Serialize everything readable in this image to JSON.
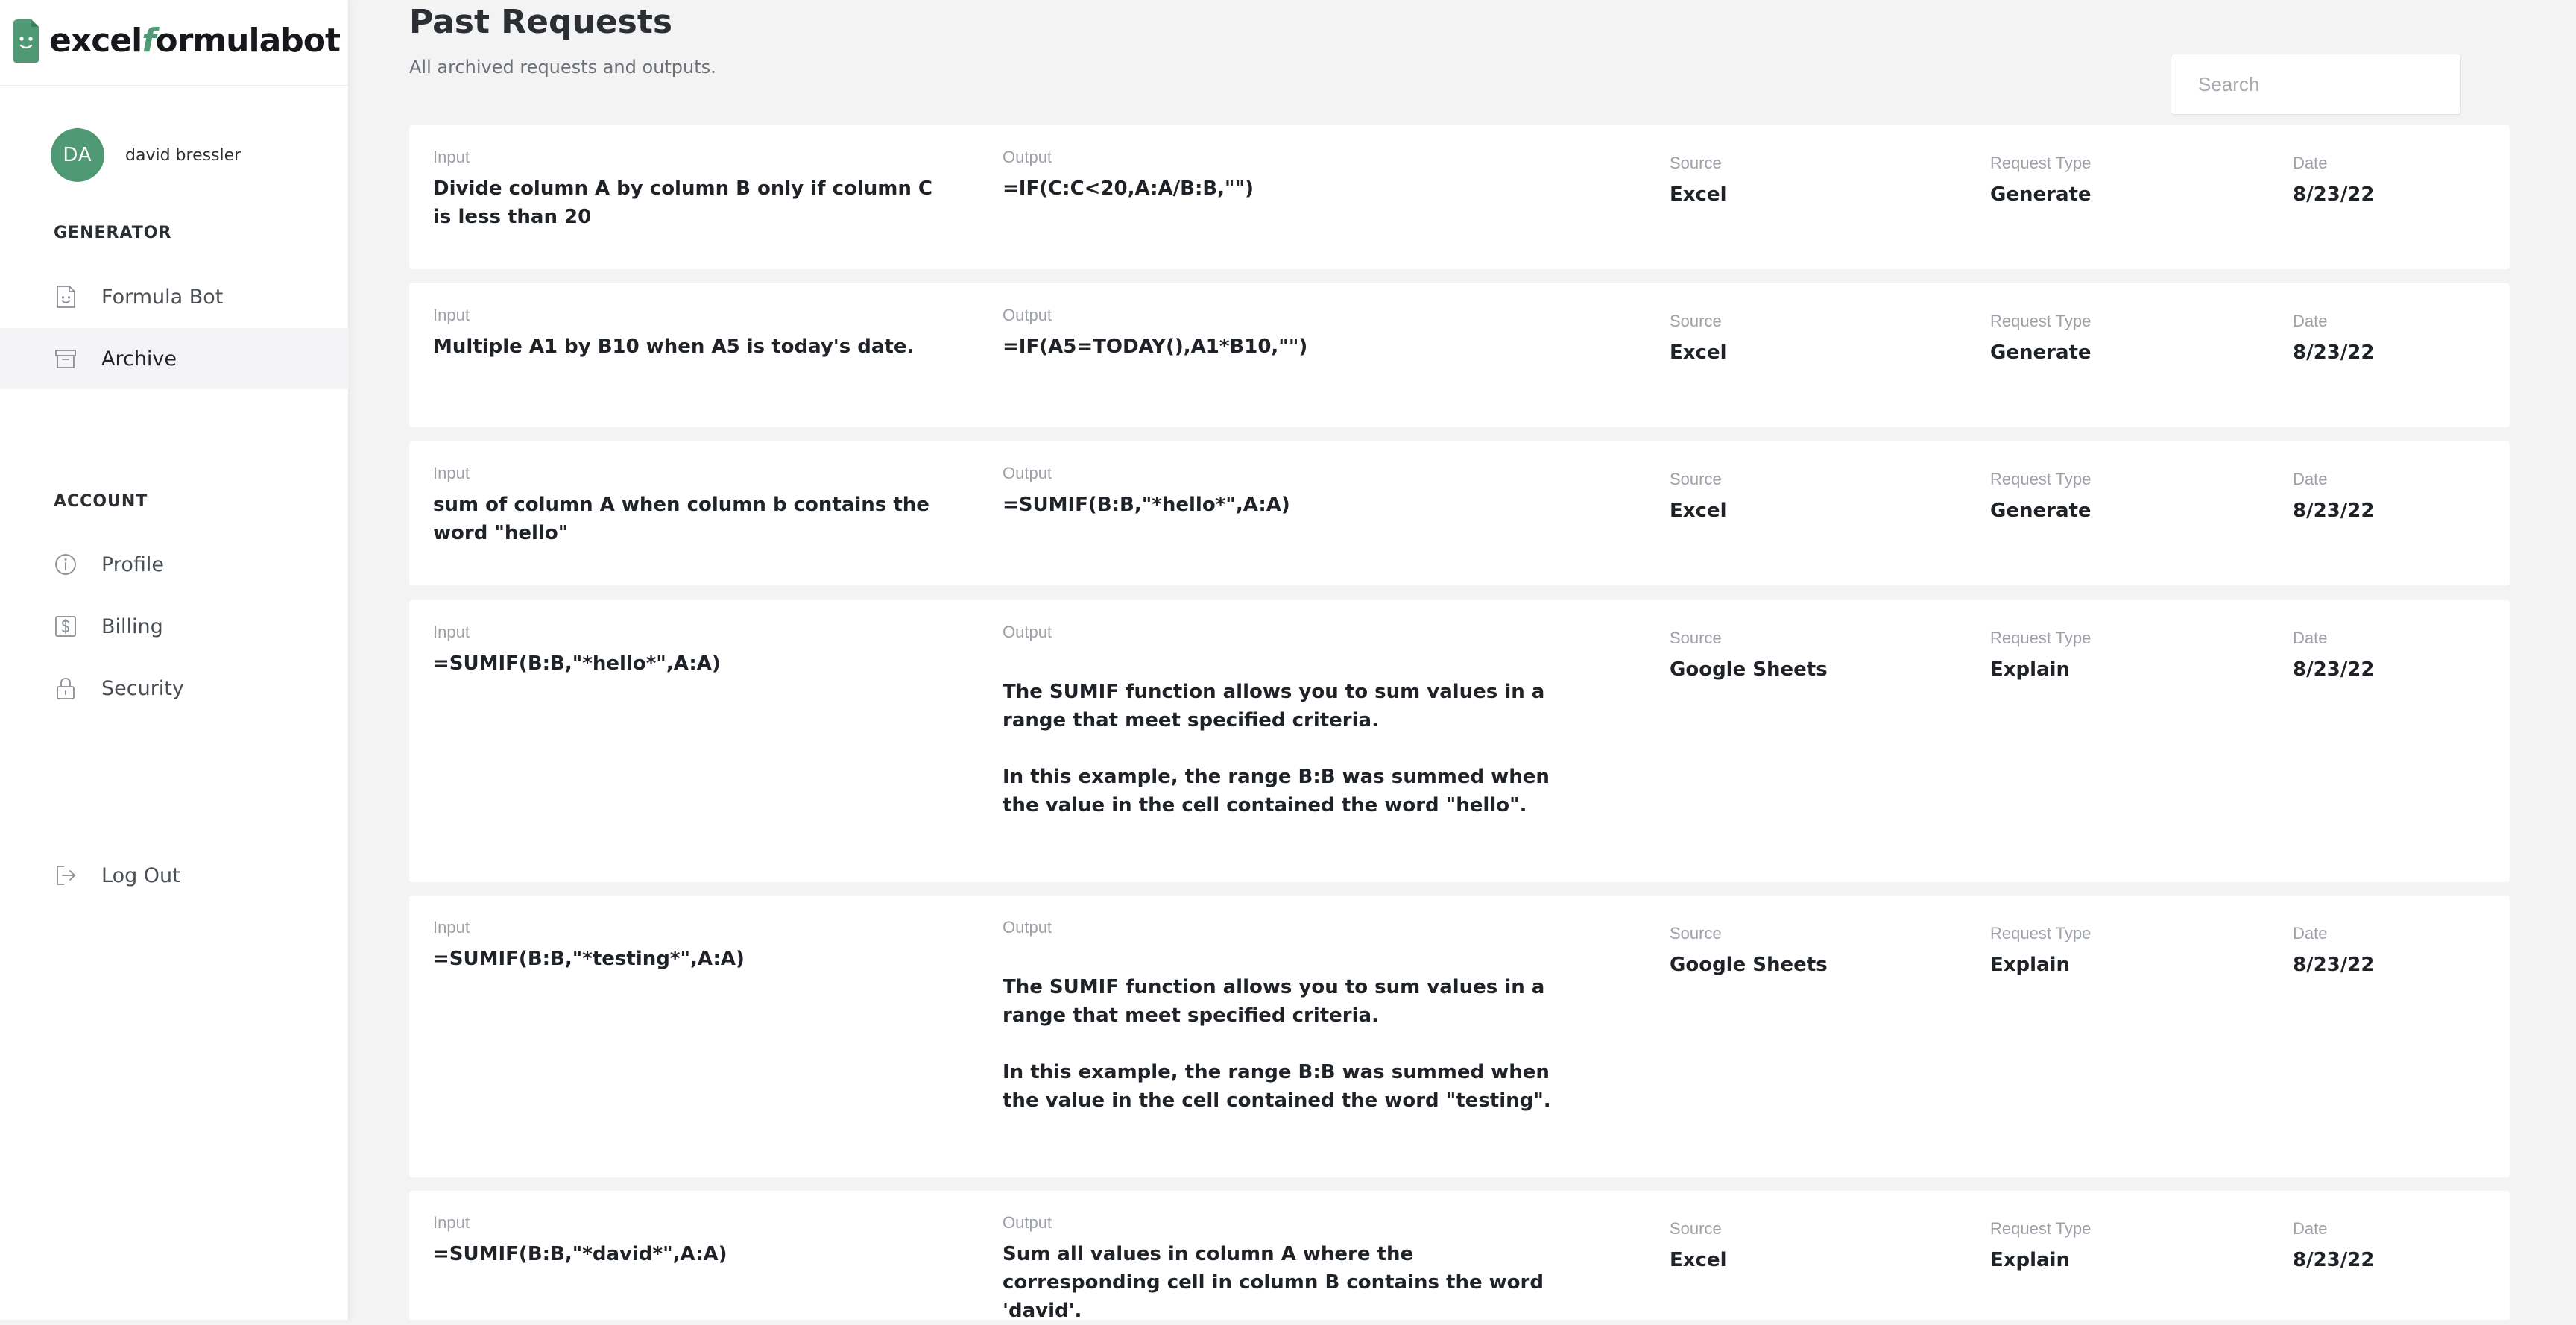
{
  "brand": {
    "name_part1": "excel",
    "name_accent": "f",
    "name_part2": "ormulabot",
    "color": "#4f9a74"
  },
  "user": {
    "initials": "DA",
    "name": "david bressler"
  },
  "sidebar": {
    "generator_label": "GENERATOR",
    "generator_items": [
      {
        "label": "Formula Bot",
        "icon": "document-face-icon",
        "active": false
      },
      {
        "label": "Archive",
        "icon": "archive-box-icon",
        "active": true
      }
    ],
    "account_label": "ACCOUNT",
    "account_items": [
      {
        "label": "Profile",
        "icon": "info-circle-icon"
      },
      {
        "label": "Billing",
        "icon": "dollar-icon"
      },
      {
        "label": "Security",
        "icon": "lock-icon"
      }
    ],
    "logout_label": "Log Out"
  },
  "page": {
    "title": "Past Requests",
    "subtitle": "All archived requests and outputs.",
    "search_placeholder": "Search"
  },
  "labels": {
    "input": "Input",
    "output": "Output",
    "source": "Source",
    "type": "Request Type",
    "date": "Date"
  },
  "requests": [
    {
      "input": "Divide column A by column B only if column C is less than 20",
      "output": [
        "=IF(C:C<20,A:A/B:B,\"\")"
      ],
      "source": "Excel",
      "type": "Generate",
      "date": "8/23/22"
    },
    {
      "input": "Multiple A1 by B10 when A5 is today's date.",
      "output": [
        "=IF(A5=TODAY(),A1*B10,\"\")"
      ],
      "source": "Excel",
      "type": "Generate",
      "date": "8/23/22"
    },
    {
      "input": "sum of column A when column b contains the word \"hello\"",
      "output": [
        "=SUMIF(B:B,\"*hello*\",A:A)"
      ],
      "source": "Excel",
      "type": "Generate",
      "date": "8/23/22"
    },
    {
      "input": "=SUMIF(B:B,\"*hello*\",A:A)",
      "output": [
        "The SUMIF function allows you to sum values in a range that meet specified criteria.",
        "In this example, the range B:B was summed when the value in the cell contained the word \"hello\"."
      ],
      "source": "Google Sheets",
      "type": "Explain",
      "date": "8/23/22"
    },
    {
      "input": "=SUMIF(B:B,\"*testing*\",A:A)",
      "output": [
        "The SUMIF function allows you to sum values in a range that meet specified criteria.",
        "In this example, the range B:B was summed when the value in the cell contained the word \"testing\"."
      ],
      "source": "Google Sheets",
      "type": "Explain",
      "date": "8/23/22"
    },
    {
      "input": "=SUMIF(B:B,\"*david*\",A:A)",
      "output": [
        "Sum all values in column A where the corresponding cell in column B contains the word 'david'."
      ],
      "source": "Excel",
      "type": "Explain",
      "date": "8/23/22"
    }
  ]
}
